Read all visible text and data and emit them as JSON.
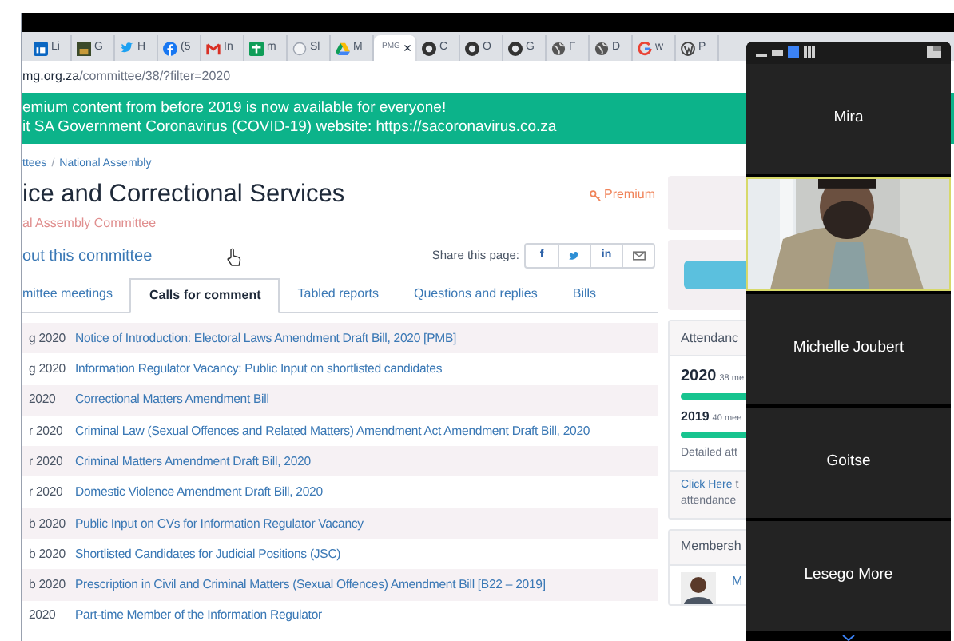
{
  "browser": {
    "tabs": [
      {
        "kind": "linkedin",
        "label": "Li",
        "selected": false
      },
      {
        "label": "G",
        "selected": false
      },
      {
        "kind": "twitter",
        "label": "H",
        "selected": false
      },
      {
        "kind": "facebook",
        "label": "(5",
        "selected": false
      },
      {
        "kind": "gmail",
        "label": "In",
        "selected": false
      },
      {
        "kind": "sheets",
        "label": "m",
        "selected": false
      },
      {
        "kind": "blank",
        "label": "Sl",
        "selected": false
      },
      {
        "kind": "drive",
        "label": "M",
        "selected": false
      },
      {
        "kind": "pmg",
        "label": "PMG",
        "selected": true,
        "close": "×"
      },
      {
        "kind": "github",
        "label": "C",
        "selected": false
      },
      {
        "kind": "github",
        "label": "O",
        "selected": false
      },
      {
        "kind": "github",
        "label": "G",
        "selected": false
      },
      {
        "kind": "globe",
        "label": "F",
        "selected": false
      },
      {
        "kind": "globe",
        "label": "D",
        "selected": false
      },
      {
        "kind": "google",
        "label": "w",
        "selected": false
      },
      {
        "kind": "wordpress",
        "label": "P",
        "selected": false
      }
    ],
    "address": {
      "host": "mg.org.za",
      "path": "/committee/38/?filter=2020"
    }
  },
  "banner": [
    "emium content from before 2019 is now available for everyone!",
    "it SA Government Coronavirus (COVID-19) website: https://sacoronavirus.co.za"
  ],
  "breadcrumb": [
    "ttees",
    "/",
    "National Assembly"
  ],
  "title": "ice and Correctional Services",
  "subtitle": "al Assembly Committee",
  "premium": "Premium",
  "about_link": "out this committee",
  "share": {
    "label": "Share this page:",
    "buttons": [
      {
        "kind": "facebook",
        "text": "f"
      },
      {
        "kind": "twitter"
      },
      {
        "kind": "linkedin",
        "text": "in"
      },
      {
        "kind": "mail"
      }
    ]
  },
  "tabs": [
    {
      "label": "mittee meetings",
      "selected": false
    },
    {
      "label": "Calls for comment",
      "selected": true
    },
    {
      "label": "Tabled reports",
      "selected": false
    },
    {
      "label": "Questions and replies",
      "selected": false
    },
    {
      "label": "Bills",
      "selected": false
    }
  ],
  "rows": [
    {
      "date": "g 2020",
      "title": "Notice of Introduction: Electoral Laws Amendment Draft Bill, 2020 [PMB]"
    },
    {
      "date": "g 2020",
      "title": "Information Regulator Vacancy: Public Input on shortlisted candidates"
    },
    {
      "date": "2020",
      "title": "Correctional Matters Amendment Bill"
    },
    {
      "date": "r 2020",
      "title": "Criminal Law (Sexual Offences and Related Matters) Amendment Act Amendment Draft Bill, 2020"
    },
    {
      "date": "r 2020",
      "title": "Criminal Matters Amendment Draft Bill, 2020"
    },
    {
      "date": "r 2020",
      "title": "Domestic Violence Amendment Draft Bill, 2020"
    },
    {
      "date": "b 2020",
      "title": "Public Input on CVs for Information Regulator Vacancy"
    },
    {
      "date": "b 2020",
      "title": "Shortlisted Candidates for Judicial Positions (JSC)"
    },
    {
      "date": "b 2020",
      "title": "Prescription in Civil and Criminal Matters (Sexual Offences) Amendment Bill [B22 – 2019]"
    },
    {
      "date": "2020",
      "title": "Part-time Member of the Information Regulator"
    }
  ],
  "sidebar": {
    "attendance": {
      "heading": "Attendanc",
      "years": [
        {
          "year": "2020",
          "meetings": "38 me"
        },
        {
          "year": "2019",
          "meetings": "40 mee"
        }
      ],
      "detail": "Detailed att",
      "link": "Click Here",
      "link_rest": "t",
      "line2": "attendance"
    },
    "membership": {
      "heading": "Membersh",
      "member": "M"
    }
  },
  "video": {
    "toolbar": [
      {
        "kind": "minimize",
        "selected": false
      },
      {
        "kind": "single",
        "selected": false
      },
      {
        "kind": "list",
        "selected": true
      },
      {
        "kind": "grid",
        "selected": false
      }
    ],
    "tiles": [
      {
        "kind": "name",
        "name": "Mira",
        "speaking": false
      },
      {
        "kind": "camera",
        "speaking": true
      },
      {
        "kind": "name",
        "name": "Michelle Joubert",
        "speaking": false
      },
      {
        "kind": "name",
        "name": "Goitse",
        "speaking": false
      },
      {
        "kind": "name",
        "name": "Lesego More",
        "speaking": false
      }
    ]
  }
}
